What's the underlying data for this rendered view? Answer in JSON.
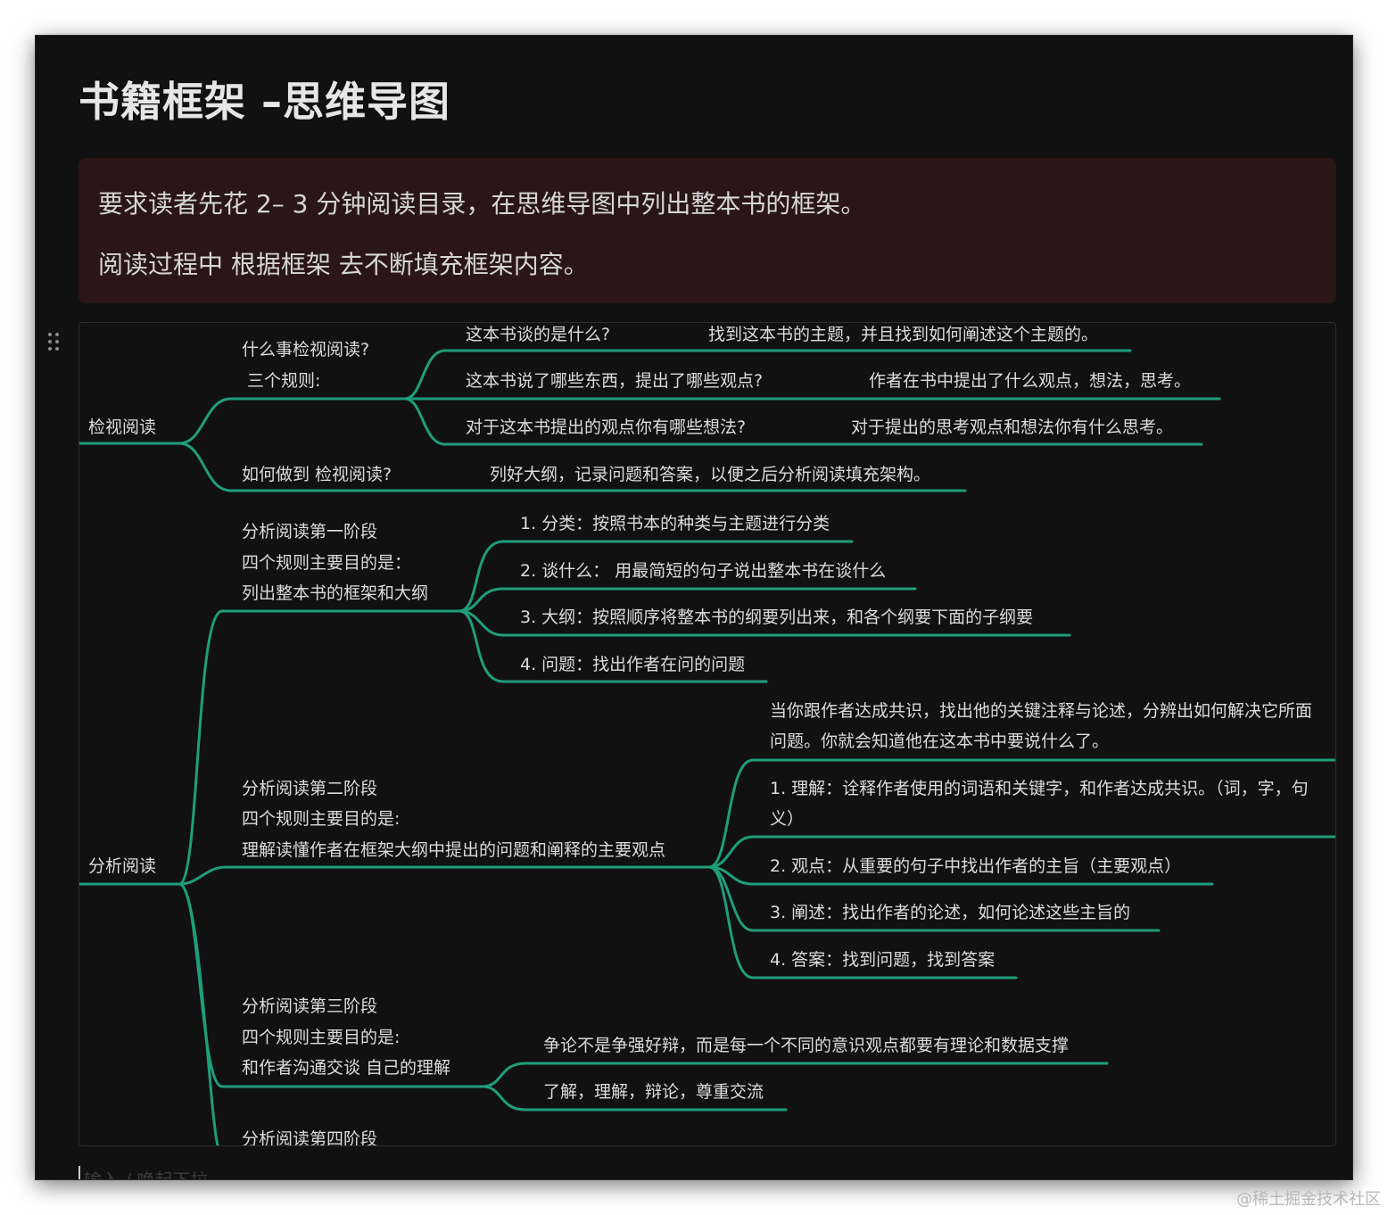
{
  "page": {
    "title": "书籍框架 –思维导图",
    "callout_lines": [
      "要求读者先花 2– 3 分钟阅读目录，在思维导图中列出整本书的框架。",
      "阅读过程中 根据框架 去不断填充框架内容。"
    ],
    "input_placeholder": "输入 / 唤起下拉"
  },
  "colors": {
    "background": "#111111",
    "callout_bg": "#2a1616",
    "branch_line": "#1f9e7a",
    "text": "#dcdcdc"
  },
  "mindmap": {
    "nodes": {
      "root1": "检视阅读",
      "n_what": "什么事检视阅读?",
      "n_rules": "三个规则:",
      "q1": "这本书谈的是什么?",
      "a1": "找到这本书的主题，并且找到如何阐述这个主题的。",
      "q2": "这本书说了哪些东西，提出了哪些观点?",
      "a2": "作者在书中提出了什么观点，想法，思考。",
      "q3": "对于这本书提出的观点你有哪些想法?",
      "a3": "对于提出的思考观点和想法你有什么思考。",
      "how": "如何做到 检视阅读?",
      "how_a": "列好大纲，记录问题和答案，以便之后分析阅读填充架构。",
      "root2": "分析阅读",
      "s1_l1": "分析阅读第一阶段",
      "s1_l2": "四个规则主要目的是：",
      "s1_l3": "列出整本书的框架和大纲",
      "s1_r1": "1. 分类：按照书本的种类与主题进行分类",
      "s1_r2": "2. 谈什么：  用最简短的句子说出整本书在谈什么",
      "s1_r3": "3. 大纲：按照顺序将整本书的纲要列出来，和各个纲要下面的子纲要",
      "s1_r4": "4. 问题：找出作者在问的问题",
      "s2_l1": "分析阅读第二阶段",
      "s2_l2": "四个规则主要目的是:",
      "s2_l3": "理解读懂作者在框架大纲中提出的问题和阐释的主要观点",
      "s2_intro1": "当你跟作者达成共识，找出他的关键注释与论述，分辨出如何解决它所面",
      "s2_intro2": "问题。你就会知道他在这本书中要说什么了。",
      "s2_r1a": "1. 理解：诠释作者使用的词语和关键字，和作者达成共识。（词，字，句",
      "s2_r1b": "义）",
      "s2_r2": "2. 观点：从重要的句子中找出作者的主旨（主要观点）",
      "s2_r3": "3. 阐述：找出作者的论述，如何论述这些主旨的",
      "s2_r4": "4. 答案：找到问题，找到答案",
      "s3_l1": "分析阅读第三阶段",
      "s3_l2": "四个规则主要目的是:",
      "s3_l3": "和作者沟通交谈 自己的理解",
      "s3_r1": "争论不是争强好辩，而是每一个不同的意识观点都要有理论和数据支撑",
      "s3_r2": "了解，理解，辩论，尊重交流",
      "s4_l1": "分析阅读第四阶段"
    }
  },
  "watermark": "@稀土掘金技术社区"
}
